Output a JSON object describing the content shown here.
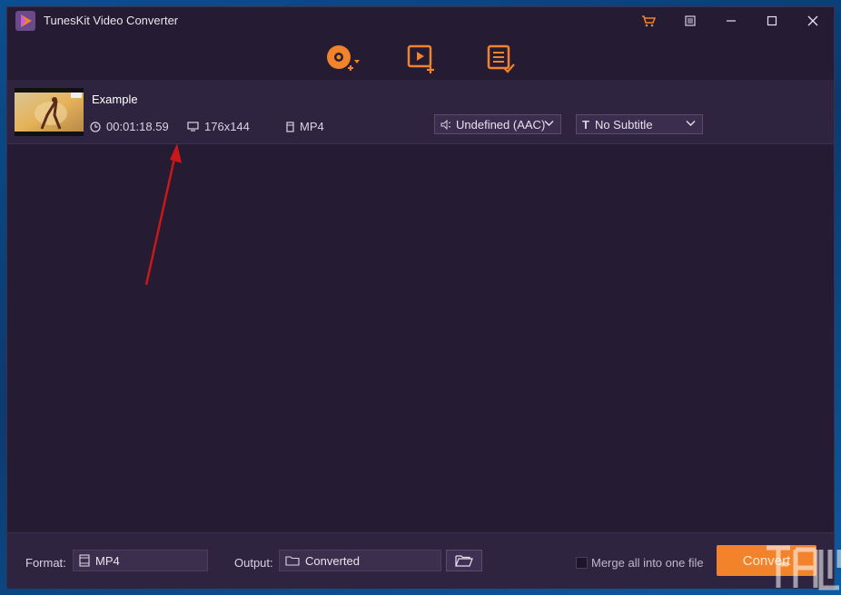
{
  "window": {
    "title": "TunesKit Video Converter",
    "accent_color": "#f2832a",
    "background_color": "#251b33"
  },
  "titlebar_buttons": [
    {
      "name": "cart-icon",
      "color": "#f2832a"
    },
    {
      "name": "menu-icon"
    },
    {
      "name": "minimize-icon"
    },
    {
      "name": "maximize-icon"
    },
    {
      "name": "close-icon"
    }
  ],
  "toolbar": {
    "tools": [
      {
        "name": "add-dvd-icon"
      },
      {
        "name": "add-video-icon"
      },
      {
        "name": "converted-history-icon"
      }
    ]
  },
  "file": {
    "name": "Example",
    "duration": "00:01:18.59",
    "resolution": "176x144",
    "format": "MP4",
    "audio_track": "Undefined (AAC)",
    "subtitle": "No Subtitle"
  },
  "footer": {
    "format_label": "Format:",
    "format_value": "MP4",
    "output_label": "Output:",
    "output_value": "Converted",
    "merge_label": "Merge all into one file",
    "merge_checked": false,
    "convert_label": "Convert"
  }
}
